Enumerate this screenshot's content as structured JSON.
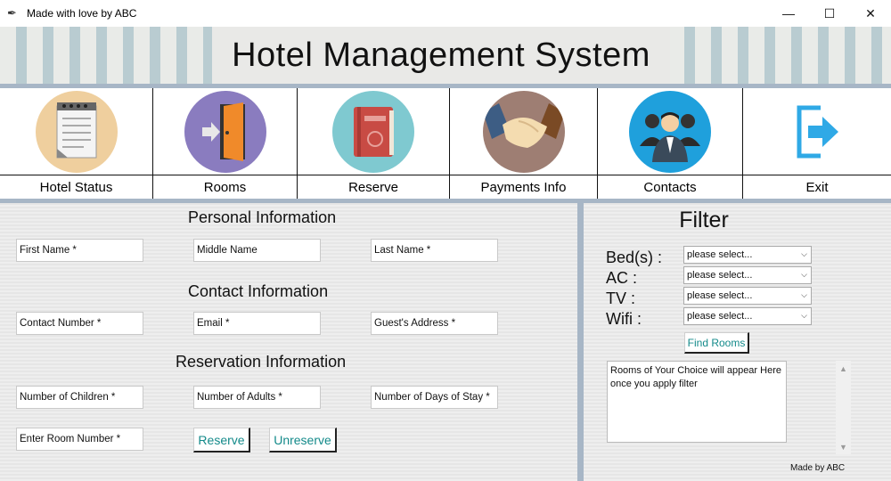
{
  "window": {
    "title": "Made with love by ABC",
    "minimize": "—",
    "maximize": "☐",
    "close": "✕"
  },
  "header": {
    "title": "Hotel Management System"
  },
  "nav": {
    "items": [
      {
        "label": "Hotel Status",
        "icon": "notepad-icon"
      },
      {
        "label": "Rooms",
        "icon": "door-icon"
      },
      {
        "label": "Reserve",
        "icon": "book-icon"
      },
      {
        "label": "Payments Info",
        "icon": "handshake-icon"
      },
      {
        "label": "Contacts",
        "icon": "people-icon"
      },
      {
        "label": "Exit",
        "icon": "exit-icon"
      }
    ]
  },
  "form": {
    "personal_heading": "Personal Information",
    "first_name": "First Name *",
    "middle_name": "Middle Name",
    "last_name": "Last Name *",
    "contact_heading": "Contact Information",
    "contact_number": "Contact Number *",
    "email": "Email *",
    "guest_address": "Guest's Address *",
    "reservation_heading": "Reservation Information",
    "children": "Number of Children *",
    "adults": "Number of Adults *",
    "days": "Number of Days of Stay *",
    "room_number": "Enter Room Number *",
    "reserve_btn": "Reserve",
    "unreserve_btn": "Unreserve"
  },
  "filter": {
    "title": "Filter",
    "beds_label": "Bed(s) :",
    "ac_label": "AC :",
    "tv_label": "TV :",
    "wifi_label": "Wifi :",
    "select_placeholder": "please select...",
    "find_btn": "Find Rooms",
    "results_line1": "Rooms of Your Choice will appear Here",
    "results_line2": "once you apply filter",
    "footer": "Made by ABC"
  },
  "colors": {
    "accent_text": "#138a8a",
    "separator": "#a7b6c6"
  }
}
